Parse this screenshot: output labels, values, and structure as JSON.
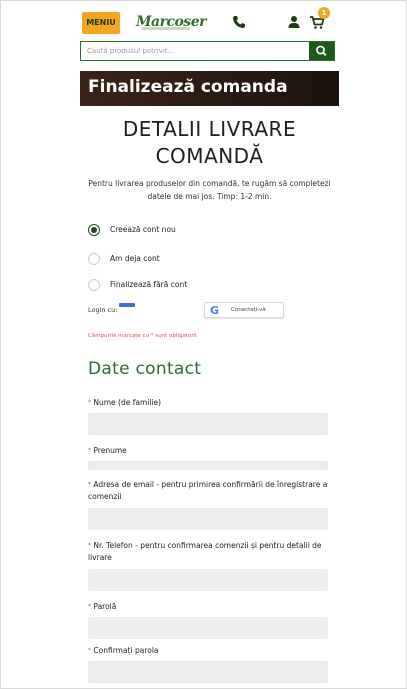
{
  "header": {
    "menu_label": "MENIU",
    "logo_text": "Marcoser",
    "cart_count": "1",
    "icons": [
      "phone-icon",
      "user-icon",
      "cart-icon",
      "search-icon"
    ]
  },
  "search": {
    "placeholder": "Caută produsul potrivit..."
  },
  "banner": {
    "title": "Finalizează comanda"
  },
  "main": {
    "heading": "DETALII LIVRARE COMANDĂ",
    "intro": "Pentru livrarea produselor din comandă, te rugăm să completezi datele de mai jos. Timp: 1-2 min."
  },
  "account_options": [
    {
      "label": "Creează cont nou",
      "selected": true
    },
    {
      "label": "Am deja cont",
      "selected": false
    },
    {
      "label": "Finalizează fără cont",
      "selected": false
    }
  ],
  "login": {
    "label": "Login cu:",
    "google_button": "Conectați-vă"
  },
  "required_note": "Câmpurile marcate cu * sunt obligatorii",
  "contact": {
    "title": "Date contact",
    "fields": [
      {
        "label": "Nume (de familie)",
        "value": ""
      },
      {
        "label": "Prenume",
        "value": ""
      },
      {
        "label": "Adresa de email - pentru primirea confirmării de înregistrare a comenzii",
        "value": ""
      },
      {
        "label": "Nr. Telefon - pentru confirmarea comenzii și pentru detalii de livrare",
        "value": ""
      },
      {
        "label": "Parolă",
        "value": ""
      },
      {
        "label": "Confirmați parola",
        "value": ""
      }
    ],
    "required_marker": "*"
  },
  "colors": {
    "accent_green": "#2f6b30",
    "menu_orange": "#f4a623",
    "required_red": "#d9534f",
    "field_bg": "#ececec"
  }
}
